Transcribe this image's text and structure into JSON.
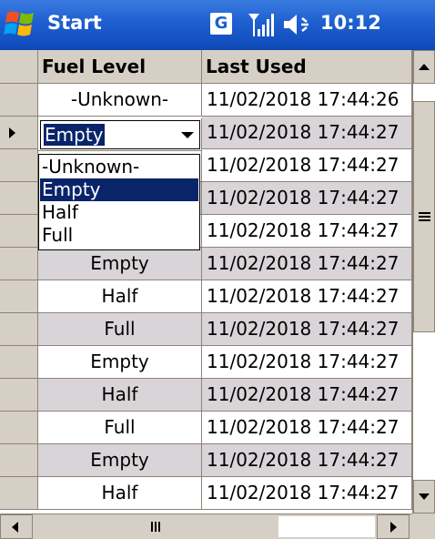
{
  "titlebar": {
    "title": "Start",
    "g_label": "G",
    "time": "10:12",
    "icons": [
      "windows-logo-icon",
      "g-icon",
      "signal-icon",
      "volume-icon"
    ]
  },
  "grid": {
    "columns": [
      "Fuel Level",
      "Last Used"
    ],
    "rows": [
      {
        "fuel": "-Unknown-",
        "last_used": "11/02/2018 17:44:26"
      },
      {
        "fuel": "Empty",
        "last_used": "11/02/2018 17:44:27"
      },
      {
        "fuel": "",
        "last_used": "11/02/2018 17:44:27"
      },
      {
        "fuel": "",
        "last_used": "11/02/2018 17:44:27"
      },
      {
        "fuel": "",
        "last_used": "11/02/2018 17:44:27"
      },
      {
        "fuel": "Empty",
        "last_used": "11/02/2018 17:44:27"
      },
      {
        "fuel": "Half",
        "last_used": "11/02/2018 17:44:27"
      },
      {
        "fuel": "Full",
        "last_used": "11/02/2018 17:44:27"
      },
      {
        "fuel": "Empty",
        "last_used": "11/02/2018 17:44:27"
      },
      {
        "fuel": "Half",
        "last_used": "11/02/2018 17:44:27"
      },
      {
        "fuel": "Full",
        "last_used": "11/02/2018 17:44:27"
      },
      {
        "fuel": "Empty",
        "last_used": "11/02/2018 17:44:27"
      },
      {
        "fuel": "Half",
        "last_used": "11/02/2018 17:44:27"
      }
    ],
    "editor": {
      "selected_value": "Empty",
      "options": [
        "-Unknown-",
        "Empty",
        "Half",
        "Full"
      ],
      "highlighted_option": "Empty"
    }
  },
  "colors": {
    "titlebar": "#1e5fd0",
    "header_bg": "#d6cfc6",
    "alt_row": "#d8d4d8",
    "selection": "#0a246a"
  }
}
